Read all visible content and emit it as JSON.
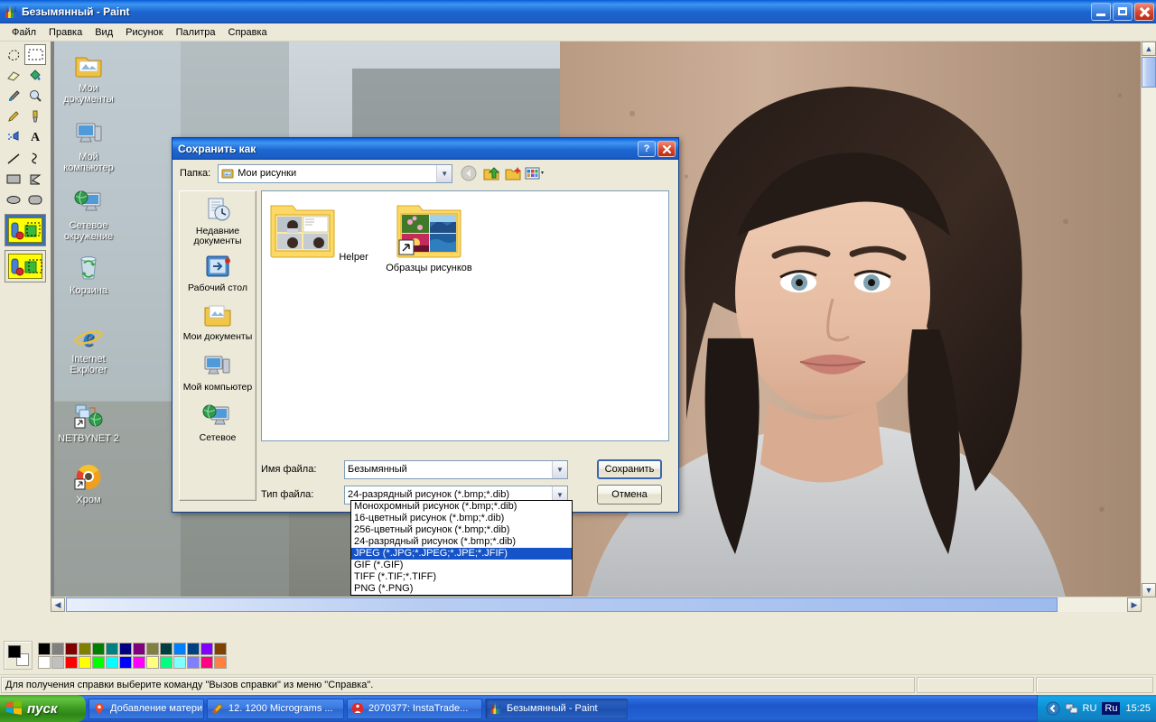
{
  "window": {
    "title": "Безымянный - Paint",
    "icon": "paint-icon",
    "minimize": "–",
    "maximize": "❐",
    "close": "✕"
  },
  "menubar": {
    "items": [
      {
        "label": "Файл"
      },
      {
        "label": "Правка"
      },
      {
        "label": "Вид"
      },
      {
        "label": "Рисунок"
      },
      {
        "label": "Палитра"
      },
      {
        "label": "Справка"
      }
    ]
  },
  "toolbox": {
    "tools": [
      {
        "name": "free-form-select-tool",
        "glyph": "✧"
      },
      {
        "name": "rectangle-select-tool",
        "glyph": "▢",
        "selected": true
      },
      {
        "name": "eraser-tool",
        "glyph": "▱"
      },
      {
        "name": "fill-tool",
        "glyph": "◆"
      },
      {
        "name": "color-picker-tool",
        "glyph": "⚲"
      },
      {
        "name": "magnifier-tool",
        "glyph": "🔍"
      },
      {
        "name": "pencil-tool",
        "glyph": "✎"
      },
      {
        "name": "brush-tool",
        "glyph": "⌇"
      },
      {
        "name": "airbrush-tool",
        "glyph": "❧"
      },
      {
        "name": "text-tool",
        "glyph": "A"
      },
      {
        "name": "line-tool",
        "glyph": "╲"
      },
      {
        "name": "curve-tool",
        "glyph": "∿"
      },
      {
        "name": "rectangle-tool",
        "glyph": "▭"
      },
      {
        "name": "polygon-tool",
        "glyph": "⬠"
      },
      {
        "name": "ellipse-tool",
        "glyph": "⬭"
      },
      {
        "name": "rounded-rectangle-tool",
        "glyph": "▢"
      }
    ],
    "options": [
      {
        "name": "opaque-selection-option",
        "selected": true
      },
      {
        "name": "transparent-selection-option",
        "selected": false
      }
    ]
  },
  "statusbar": {
    "hint": "Для получения справки выберите команду \"Вызов справки\" из меню \"Справка\".",
    "pane2": "",
    "pane3": ""
  },
  "palette": {
    "foreground": "#000000",
    "background": "#ffffff",
    "row1": [
      "#000000",
      "#808080",
      "#800000",
      "#808000",
      "#008000",
      "#008080",
      "#000080",
      "#800080",
      "#808040",
      "#004040",
      "#0080ff",
      "#004080",
      "#8000ff",
      "#804000"
    ],
    "row2": [
      "#ffffff",
      "#c0c0c0",
      "#ff0000",
      "#ffff00",
      "#00ff00",
      "#00ffff",
      "#0000ff",
      "#ff00ff",
      "#ffff80",
      "#00ff80",
      "#80ffff",
      "#8080ff",
      "#ff0080",
      "#ff8040"
    ]
  },
  "desktop": {
    "icons": [
      {
        "label": "Мои документы",
        "icon": "documents-folder-icon"
      },
      {
        "label": "Мой компьютер",
        "icon": "my-computer-icon"
      },
      {
        "label": "Сетевое окружение",
        "icon": "network-places-icon"
      },
      {
        "label": "Корзина",
        "icon": "recycle-bin-icon"
      },
      {
        "label": "Internet Explorer",
        "icon": "internet-explorer-icon"
      },
      {
        "label": "NETBYNET 2",
        "icon": "network-shortcut-icon"
      },
      {
        "label": "Хром",
        "icon": "chrome-icon"
      }
    ]
  },
  "dialog": {
    "title": "Сохранить как",
    "help_btn": "?",
    "close_btn": "✕",
    "lookin_label": "Папка:",
    "lookin_value": "Мои рисунки",
    "toolbar": [
      {
        "name": "back-button",
        "glyph": "◀"
      },
      {
        "name": "up-one-level-button",
        "glyph": "▲"
      },
      {
        "name": "new-folder-button",
        "glyph": "✱"
      },
      {
        "name": "views-button",
        "glyph": "▦"
      }
    ],
    "places": [
      {
        "label": "Недавние документы",
        "icon": "recent-documents-icon"
      },
      {
        "label": "Рабочий стол",
        "icon": "desktop-icon"
      },
      {
        "label": "Мои документы",
        "icon": "my-documents-icon"
      },
      {
        "label": "Мой компьютер",
        "icon": "my-computer-icon"
      },
      {
        "label": "Сетевое",
        "icon": "network-icon"
      }
    ],
    "files": [
      {
        "label": "Helper",
        "icon": "folder-thumbnail-icon"
      },
      {
        "label": "Образцы рисунков",
        "icon": "folder-thumbnail-shortcut-icon"
      }
    ],
    "filename_label": "Имя файла:",
    "filename_value": "Безымянный",
    "filetype_label": "Тип файла:",
    "filetype_value": "24-разрядный рисунок (*.bmp;*.dib)",
    "save_button": "Сохранить",
    "cancel_button": "Отмена",
    "filetype_options": [
      {
        "label": "Монохромный рисунок (*.bmp;*.dib)",
        "selected": false
      },
      {
        "label": "16-цветный рисунок (*.bmp;*.dib)",
        "selected": false
      },
      {
        "label": "256-цветный рисунок (*.bmp;*.dib)",
        "selected": false
      },
      {
        "label": "24-разрядный рисунок (*.bmp;*.dib)",
        "selected": false
      },
      {
        "label": "JPEG (*.JPG;*.JPEG;*.JPE;*.JFIF)",
        "selected": true
      },
      {
        "label": "GIF (*.GIF)",
        "selected": false
      },
      {
        "label": "TIFF (*.TIF;*.TIFF)",
        "selected": false
      },
      {
        "label": "PNG (*.PNG)",
        "selected": false
      }
    ]
  },
  "taskbar": {
    "start_label": "пуск",
    "buttons": [
      {
        "label": "Добавление матери...",
        "icon": "map-pin-icon",
        "active": false
      },
      {
        "label": "12. 1200 Micrograms ...",
        "icon": "media-icon",
        "active": false
      },
      {
        "label": "2070377: InstaTrade...",
        "icon": "forum-icon",
        "active": false
      },
      {
        "label": "Безымянный - Paint",
        "icon": "paint-icon",
        "active": true
      }
    ],
    "tray": {
      "show_hidden": "«",
      "network_icon": "network-tray-icon",
      "language": "RU",
      "input_indicator": "Ru",
      "clock": "15:25"
    }
  }
}
